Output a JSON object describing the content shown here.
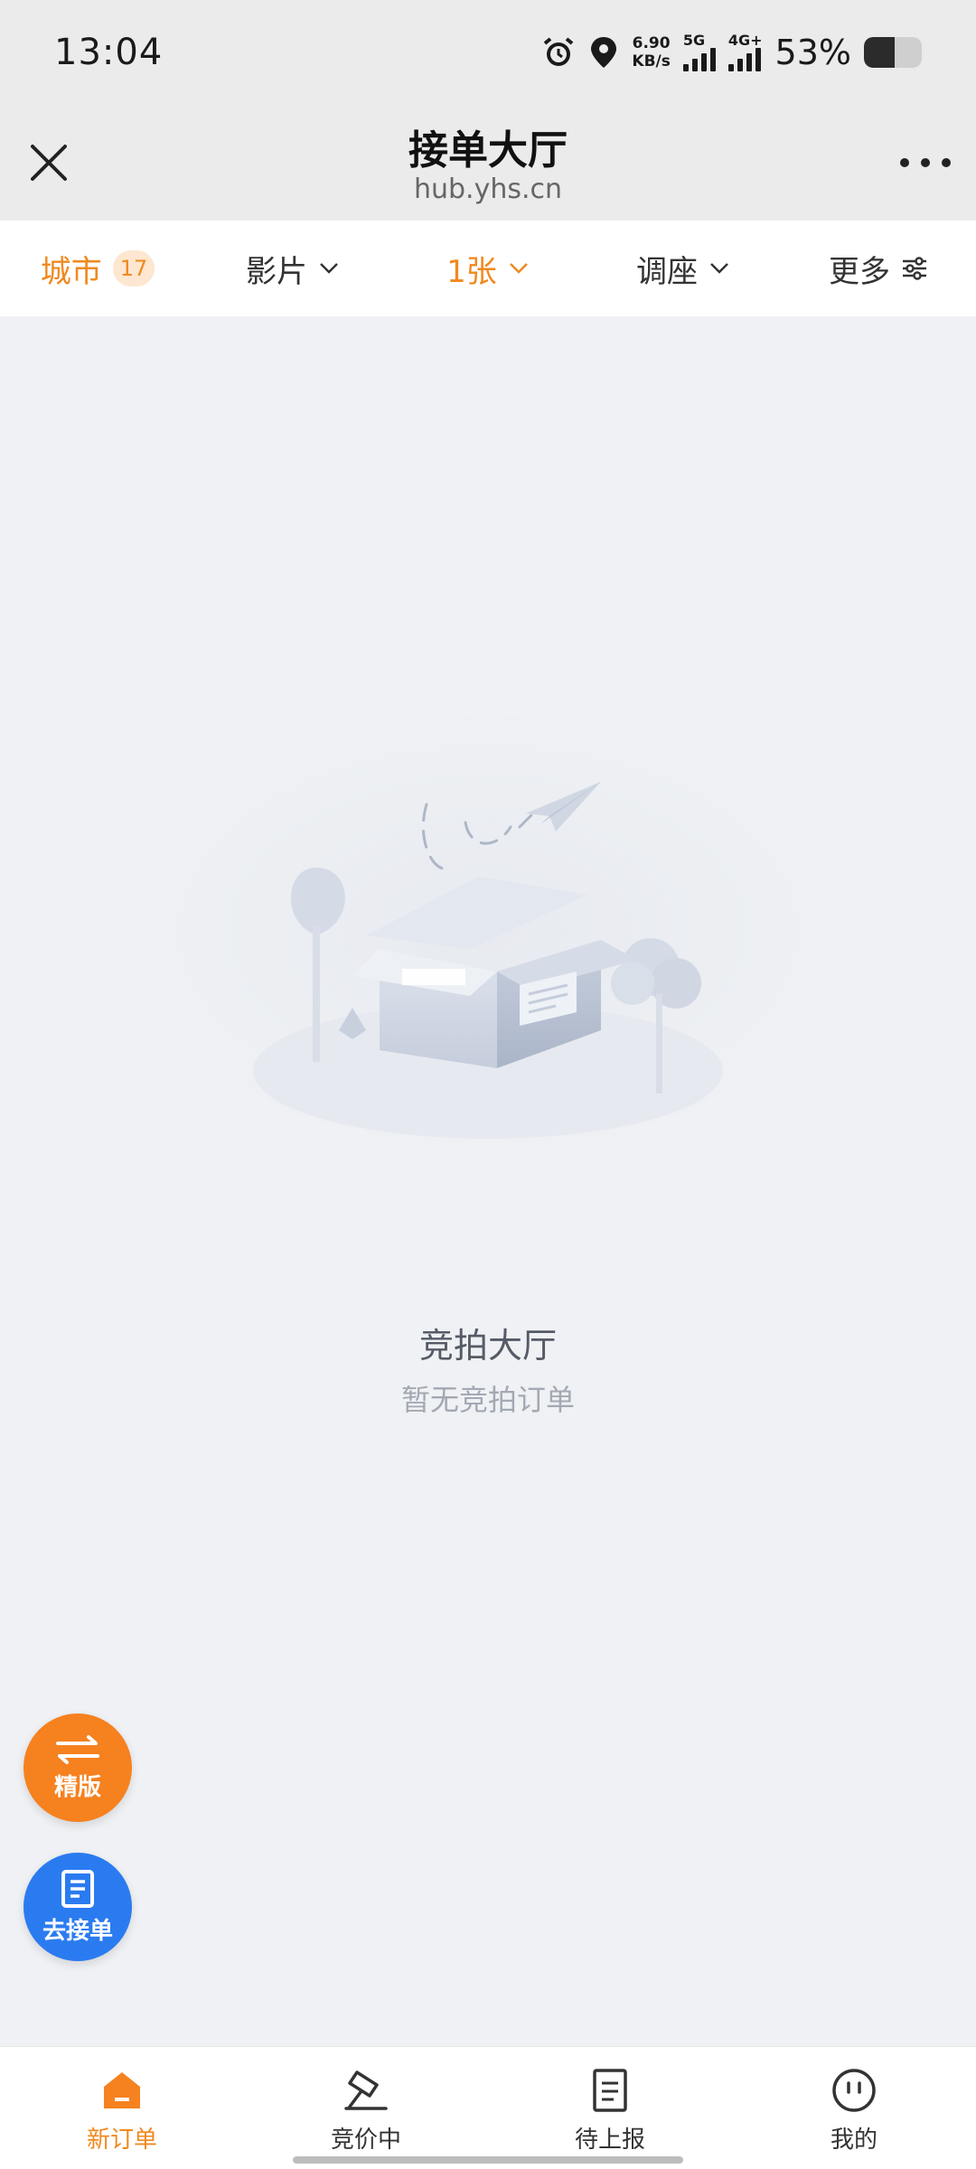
{
  "status_bar": {
    "time": "13:04",
    "net_speed_value": "6.90",
    "net_speed_unit": "KB/s",
    "signal_1_label": "5G",
    "signal_2_label": "4G+",
    "battery_percent": "53%",
    "battery_level": 0.53
  },
  "header": {
    "title": "接单大厅",
    "url": "hub.yhs.cn",
    "close_icon": "close-icon",
    "more_icon": "more-dots-icon"
  },
  "filters": [
    {
      "label": "城市",
      "badge": "17",
      "active": true
    },
    {
      "label": "影片",
      "active": false
    },
    {
      "label": "1张",
      "active": true
    },
    {
      "label": "调座",
      "active": false
    },
    {
      "label": "更多",
      "active": false
    }
  ],
  "empty_state": {
    "title": "竞拍大厅",
    "subtitle": "暂无竞拍订单",
    "illustration_icon": "empty-box-icon"
  },
  "fabs": {
    "switch_label": "精版",
    "take_order_label": "去接单"
  },
  "tabs": [
    {
      "label": "新订单",
      "icon": "home-icon",
      "active": true
    },
    {
      "label": "竞价中",
      "icon": "auction-hammer-icon",
      "active": false
    },
    {
      "label": "待上报",
      "icon": "report-doc-icon",
      "active": false
    },
    {
      "label": "我的",
      "icon": "profile-face-icon",
      "active": false
    }
  ],
  "colors": {
    "accent": "#f0891f",
    "blue": "#2b7bf0",
    "background": "#eff1f4"
  }
}
